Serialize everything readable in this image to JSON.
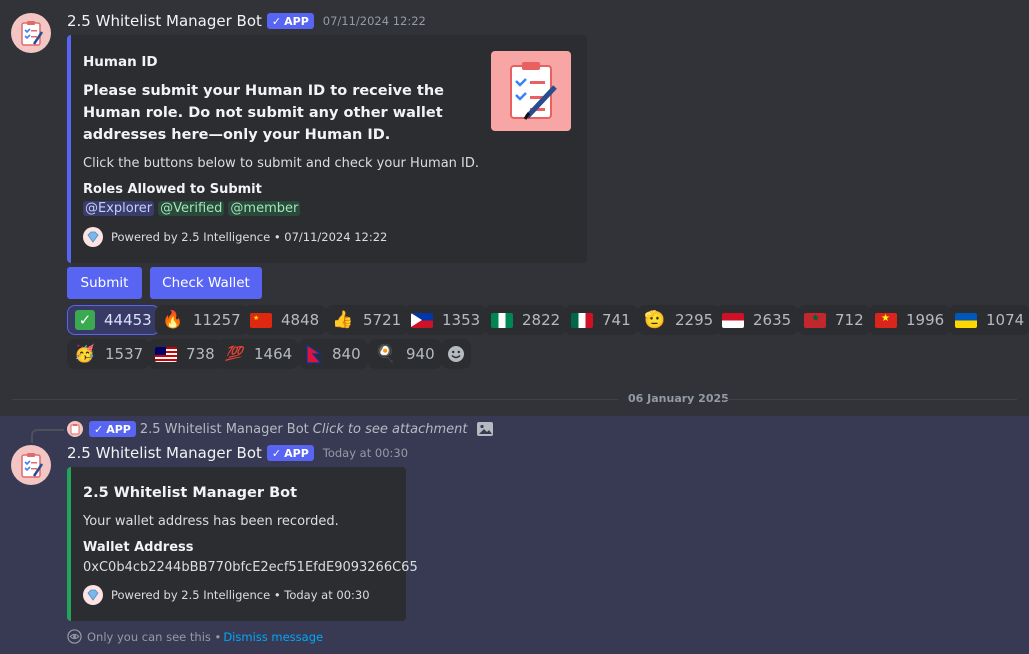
{
  "message1": {
    "username": "2.5 Whitelist Manager Bot",
    "app_badge": "APP",
    "timestamp": "07/11/2024 12:22",
    "embed": {
      "title": "Human ID",
      "description_bold": "Please submit your Human ID to receive the Human role. Do not submit any other wallet addresses here—only your Human ID.",
      "description": "Click the buttons below to submit and check your Human ID.",
      "field_name": "Roles Allowed to Submit",
      "roles": [
        "@Explorer",
        "@Verified",
        "@member"
      ],
      "footer": "Powered by 2.5 Intelligence • 07/11/2024 12:22"
    },
    "buttons": {
      "submit": "Submit",
      "check_wallet": "Check Wallet"
    },
    "reactions": [
      {
        "emoji": "✅",
        "count": "44453"
      },
      {
        "emoji": "🔥",
        "count": "11257"
      },
      {
        "emoji": "flag-cn",
        "count": "4848"
      },
      {
        "emoji": "👍",
        "count": "5721"
      },
      {
        "emoji": "flag-ph",
        "count": "1353"
      },
      {
        "emoji": "flag-ng",
        "count": "2822"
      },
      {
        "emoji": "flag-mx",
        "count": "741"
      },
      {
        "emoji": "🫡",
        "count": "2295"
      },
      {
        "emoji": "flag-id",
        "count": "2635"
      },
      {
        "emoji": "flag-ma",
        "count": "712"
      },
      {
        "emoji": "flag-vn",
        "count": "1996"
      },
      {
        "emoji": "flag-ua",
        "count": "1074"
      },
      {
        "emoji": "🥳",
        "count": "1537"
      },
      {
        "emoji": "flag-my",
        "count": "738"
      },
      {
        "emoji": "💯",
        "count": "1464"
      },
      {
        "emoji": "flag-np",
        "count": "840"
      },
      {
        "emoji": "🍳",
        "count": "940"
      }
    ]
  },
  "date_divider": "06 January 2025",
  "message2": {
    "reply": {
      "username": "2.5 Whitelist Manager Bot",
      "app_badge": "APP",
      "text": "Click to see attachment"
    },
    "username": "2.5 Whitelist Manager Bot",
    "app_badge": "APP",
    "timestamp": "Today at 00:30",
    "embed": {
      "title": "2.5 Whitelist Manager Bot",
      "description": "Your wallet address has been recorded.",
      "field_name": "Wallet Address",
      "field_value": "0xC0b4cb2244bBB770bfcE2ecf51EfdE9093266C65",
      "footer": "Powered by 2.5 Intelligence • Today at 00:30",
      "accent_color": "#23a559"
    },
    "ephemeral": {
      "text": "Only you can see this •",
      "dismiss": "Dismiss message"
    }
  }
}
